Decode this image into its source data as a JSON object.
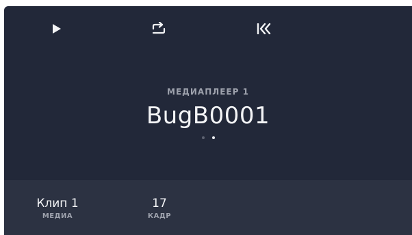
{
  "transport": {
    "play_icon": "play-icon",
    "loop_icon": "loop-icon",
    "skip_to_start_icon": "skip-to-start-icon"
  },
  "player": {
    "label": "МЕДИАПЛЕЕР 1",
    "clip_name": "BugB0001",
    "page_dots": {
      "count": 2,
      "active_index": 1
    }
  },
  "footer": {
    "media": {
      "value": "Клип 1",
      "label": "МЕДИА"
    },
    "frame": {
      "value": "17",
      "label": "КАДР"
    }
  },
  "colors": {
    "background": "#222839",
    "footer_background": "#2c3242",
    "text": "#f3f4f6",
    "muted_text": "#9ea2ad"
  }
}
